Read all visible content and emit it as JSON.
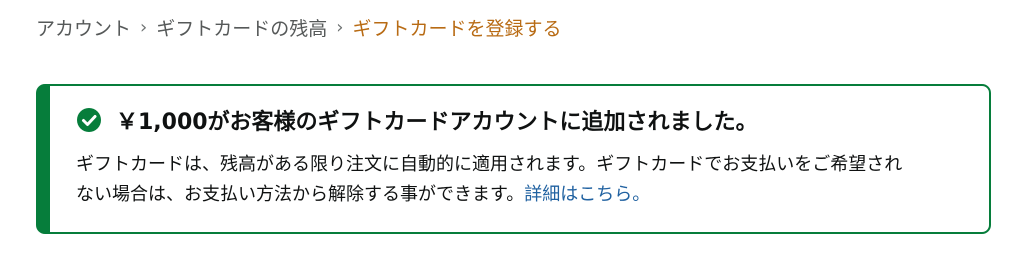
{
  "breadcrumb": {
    "items": [
      {
        "label": "アカウント"
      },
      {
        "label": "ギフトカードの残高"
      }
    ],
    "separator": "›",
    "current": "ギフトカードを登録する"
  },
  "alert": {
    "status": "success",
    "icon": "check-circle-icon",
    "color": "#067d3b",
    "heading": "￥1,000がお客様のギフトカードアカウントに追加されました。",
    "body_line1": "ギフトカードは、残高がある限り注文に自動的に適用されます。ギフトカードでお支払いをご希望され",
    "body_line2": "ない場合は、お支払い方法から解除する事ができます。",
    "link_label": "詳細はこちら。"
  },
  "colors": {
    "breadcrumb_text": "#565959",
    "breadcrumb_current": "#b86b14",
    "link": "#2162a1",
    "text": "#0f1111"
  }
}
